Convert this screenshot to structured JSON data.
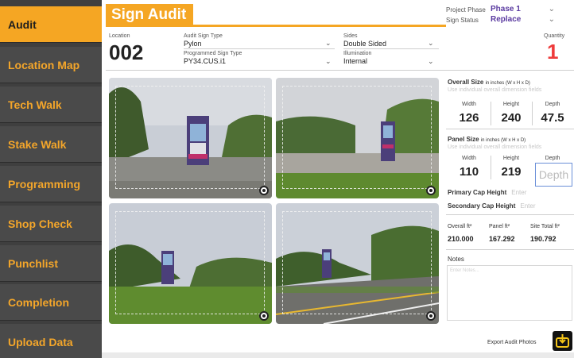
{
  "sidebar": {
    "items": [
      {
        "label": "Audit",
        "active": true
      },
      {
        "label": "Location Map"
      },
      {
        "label": "Tech Walk"
      },
      {
        "label": "Stake Walk"
      },
      {
        "label": "Programming"
      },
      {
        "label": "Shop Check"
      },
      {
        "label": "Punchlist"
      },
      {
        "label": "Completion"
      },
      {
        "label": "Upload Data"
      }
    ]
  },
  "header": {
    "title": "Sign Audit",
    "project_phase_label": "Project Phase",
    "project_phase_value": "Phase 1",
    "sign_status_label": "Sign Status",
    "sign_status_value": "Replace"
  },
  "fields": {
    "location_label": "Location",
    "location_value": "002",
    "audit_sign_type_label": "Audit Sign Type",
    "audit_sign_type_value": "Pylon",
    "programmed_sign_type_label": "Programmed Sign Type",
    "programmed_sign_type_value": "PY34.CUS.i1",
    "sides_label": "Sides",
    "sides_value": "Double Sided",
    "illumination_label": "Illumination",
    "illumination_value": "Internal",
    "quantity_label": "Quantity",
    "quantity_value": "1"
  },
  "overall_size": {
    "title": "Overall Size",
    "unit_note": "in inches (W x H x D)",
    "hint": "Use individual overall dimension fields",
    "width_label": "Width",
    "height_label": "Height",
    "depth_label": "Depth",
    "width": "126",
    "height": "240",
    "depth": "47.5"
  },
  "panel_size": {
    "title": "Panel Size",
    "unit_note": "in inches (W x H x D)",
    "hint": "Use individual overall dimension fields",
    "width_label": "Width",
    "height_label": "Height",
    "depth_label": "Depth",
    "width": "110",
    "height": "219",
    "depth_placeholder": "Depth"
  },
  "caps": {
    "primary_label": "Primary Cap Height",
    "primary_placeholder": "Enter",
    "secondary_label": "Secondary Cap Height",
    "secondary_placeholder": "Enter"
  },
  "stats": {
    "overall_label": "Overall ft²",
    "overall_value": "210.000",
    "panel_label": "Panel ft²",
    "panel_value": "167.292",
    "site_label": "Site Total ft²",
    "site_value": "190.792"
  },
  "notes": {
    "label": "Notes",
    "placeholder": "Enter Notes..."
  },
  "export": {
    "label": "Export Audit Photos"
  },
  "colors": {
    "accent": "#f5a623",
    "sidebar_bg": "#3f3f3f",
    "quantity_red": "#ee3b3b",
    "phase_purple": "#5a3aa0"
  },
  "icons": [
    "chevron-down-icon",
    "expand-icon",
    "export-icon"
  ]
}
